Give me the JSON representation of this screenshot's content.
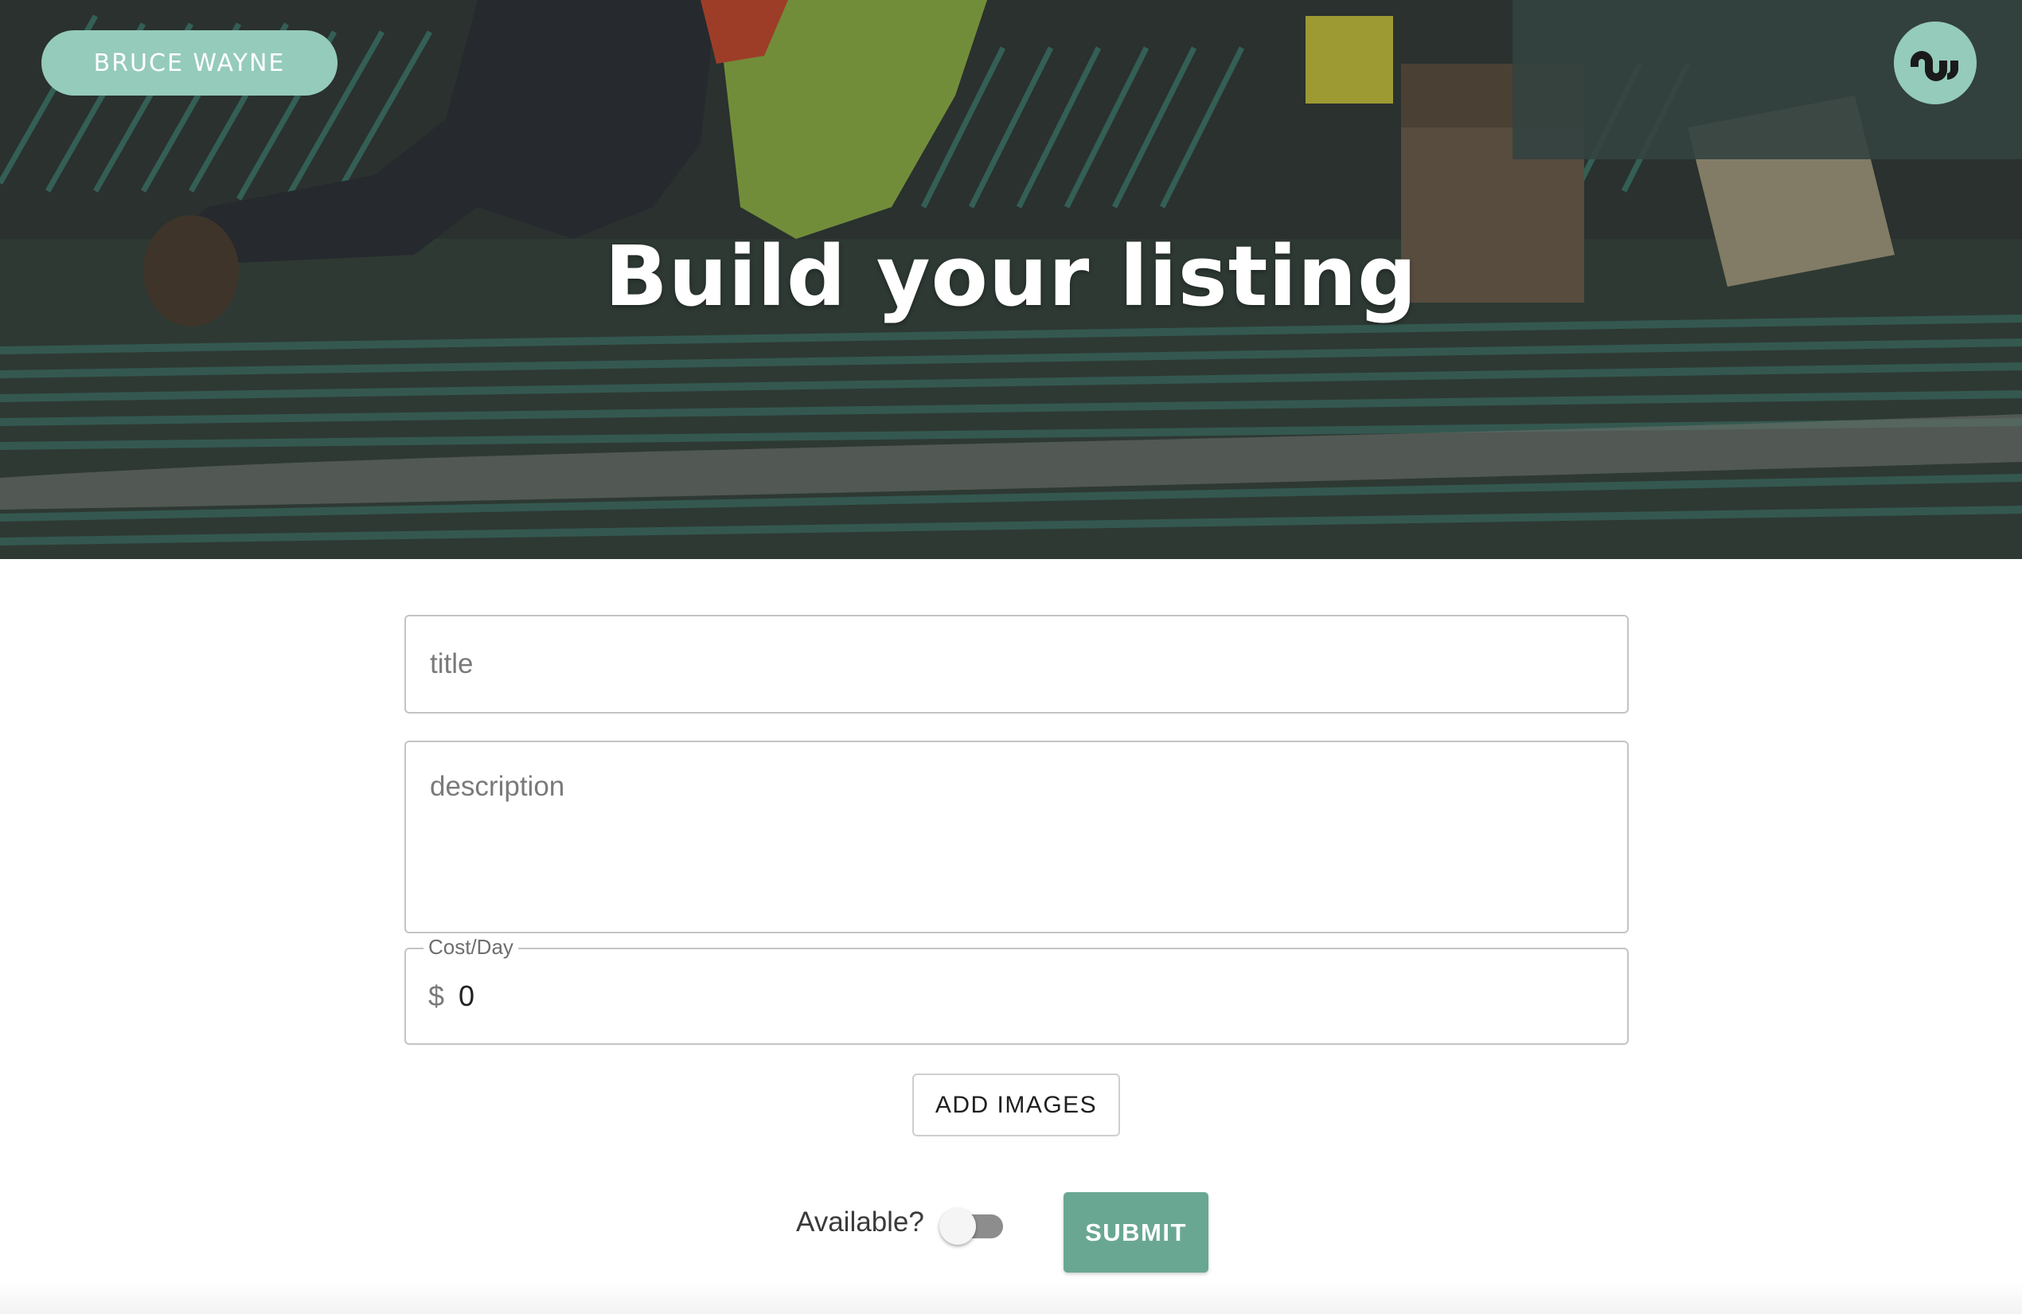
{
  "header": {
    "user_name": "BRUCE WAYNE",
    "logo_icon": "stumbleupon-icon",
    "title": "Build your listing"
  },
  "form": {
    "title_placeholder": "title",
    "description_placeholder": "description",
    "cost_label": "Cost/Day",
    "currency_symbol": "$",
    "cost_value": "0",
    "add_images_label": "ADD IMAGES",
    "available_label": "Available?",
    "available_on": false,
    "submit_label": "SUBMIT"
  },
  "colors": {
    "accent": "#95cbbb",
    "submit": "#6aa793"
  }
}
